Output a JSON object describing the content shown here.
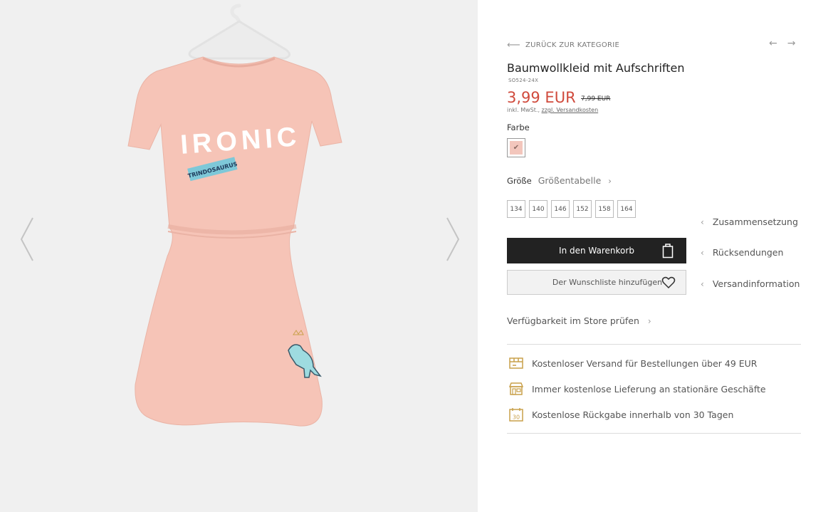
{
  "gallery": {
    "prev_icon": "chevron-left-icon",
    "next_icon": "chevron-right-icon",
    "print_text": "IRONIC",
    "patch_text": "TRINDOSAURUS"
  },
  "nav": {
    "back_label": "ZURÜCK ZUR KATEGORIE",
    "prev_arrow": "←",
    "next_arrow": "→"
  },
  "product": {
    "title": "Baumwollkleid mit Aufschriften",
    "sku": "SO524-24X",
    "price": "3,99 EUR",
    "old_price": "7,99 EUR",
    "tax_prefix": "inkl. MwSt.,",
    "shipping_link": "zzgl. Versandkosten"
  },
  "color": {
    "label": "Farbe",
    "swatch_color": "#f3c6bc",
    "check": "✔"
  },
  "size": {
    "label": "Größe",
    "chart_link": "Größentabelle",
    "chevron": "›",
    "options": [
      "134",
      "140",
      "146",
      "152",
      "158",
      "164"
    ]
  },
  "actions": {
    "cart_label": "In den Warenkorb",
    "wishlist_label": "Der Wunschliste hinzufügen"
  },
  "side_links": {
    "chevron": "‹",
    "items": [
      "Zusammensetzung",
      "Rücksendungen",
      "Versandinformation"
    ]
  },
  "store": {
    "label": "Verfügbarkeit im Store prüfen",
    "chevron": "›"
  },
  "benefits": [
    {
      "icon": "shipping-box-icon",
      "text": "Kostenloser Versand für Bestellungen über 49 EUR"
    },
    {
      "icon": "store-icon",
      "text": "Immer kostenlose Lieferung an stationäre Geschäfte"
    },
    {
      "icon": "calendar-30-icon",
      "text": "Kostenlose Rückgabe innerhalb von 30 Tagen",
      "badge": "30"
    }
  ],
  "colors": {
    "price_red": "#d04a3c",
    "dress_pink": "#f6c4b7",
    "icon_gold": "#c9a04a",
    "button_dark": "#222222"
  }
}
